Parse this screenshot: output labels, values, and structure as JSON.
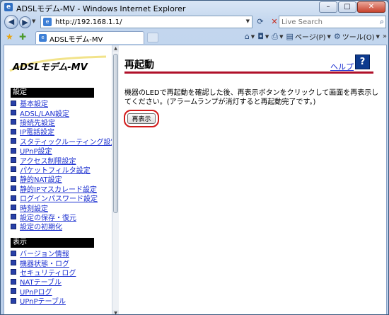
{
  "window": {
    "title": "ADSLモデム-MV - Windows Internet Explorer",
    "controls": {
      "minimize": "–",
      "maximize": "□",
      "close": "✕"
    }
  },
  "address_bar": {
    "url": "http://192.168.1.1/",
    "search_placeholder": "Live Search"
  },
  "tabs": [
    {
      "label": "ADSLモデム-MV"
    }
  ],
  "commands": {
    "page": "ページ(P)",
    "tools": "ツール(O)",
    "more": "»"
  },
  "sidebar": {
    "logo": "ADSLモデム-MV",
    "sections": [
      {
        "title": "設定",
        "items": [
          "基本設定",
          "ADSL/LAN設定",
          "接続先設定",
          "IP電話設定",
          "スタティックルーティング設定",
          "UPnP設定",
          "アクセス制限設定",
          "パケットフィルタ設定",
          "静的NAT設定",
          "静的IPマスカレード設定",
          "ログインパスワード設定",
          "時刻設定",
          "設定の保存・復元",
          "設定の初期化"
        ]
      },
      {
        "title": "表示",
        "items": [
          "バージョン情報",
          "機器状態・ログ",
          "セキュリティログ",
          "NATテーブル",
          "UPnPログ",
          "UPnPテーブル"
        ]
      }
    ]
  },
  "main": {
    "title": "再起動",
    "help_label": "ヘルプ",
    "help_icon": "?",
    "message": "機器のLEDで再起動を確認した後、再表示ボタンをクリックして画面を再表示してください。(アラームランプが消灯すると再起動完了です。)",
    "reload_button": "再表示"
  },
  "colors": {
    "accent_rule": "#b0102a",
    "link": "#1b2fd0",
    "section_bg": "#000000",
    "highlight": "#d21a1a"
  }
}
